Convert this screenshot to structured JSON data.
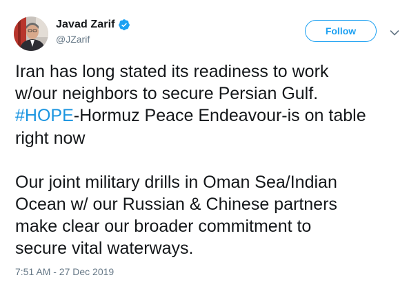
{
  "author": {
    "display_name": "Javad Zarif",
    "handle": "@JZarif",
    "verified": true,
    "avatar_icon": "profile-photo"
  },
  "actions": {
    "follow_label": "Follow",
    "more_icon": "chevron-down-icon"
  },
  "tweet": {
    "line1": "Iran has long stated its readiness to work",
    "line2": "w/our neighbors to secure Persian Gulf.",
    "hashtag": "#HOPE",
    "line3_rest": "-Hormuz Peace Endeavour-is on table",
    "line4": "right now",
    "line5": "Our joint military drills in Oman Sea/Indian",
    "line6": "Ocean w/ our Russian & Chinese partners",
    "line7": "make clear our broader commitment to",
    "line8": "secure vital waterways."
  },
  "timestamp": "7:51 AM - 27 Dec 2019",
  "colors": {
    "accent": "#1da1f2",
    "hashtag": "#1b95e0",
    "text": "#14171a",
    "muted": "#657786"
  }
}
